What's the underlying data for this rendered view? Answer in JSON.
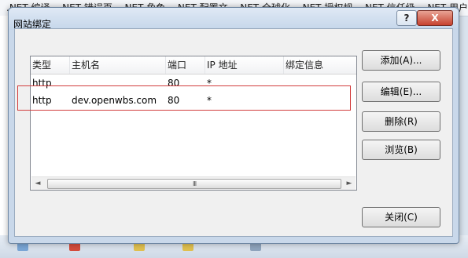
{
  "background": {
    "tabs": [
      ".NET 编译",
      ".NET 错误页",
      ".NET 角色",
      ".NET 配置文",
      ".NET 全球化",
      ".NET 授权规",
      ".NET 信任级",
      ".NET 用户"
    ]
  },
  "dialog": {
    "title": "网站绑定",
    "help_label": "?",
    "close_label": "X"
  },
  "list": {
    "columns": [
      "类型",
      "主机名",
      "端口",
      "IP 地址",
      "绑定信息"
    ],
    "rows": [
      {
        "type": "http",
        "host": "",
        "port": "80",
        "ip": "*",
        "info": ""
      },
      {
        "type": "http",
        "host": "dev.openwbs.com",
        "port": "80",
        "ip": "*",
        "info": ""
      }
    ],
    "scroll_left": "◄",
    "scroll_right": "►",
    "scroll_grip": "III"
  },
  "buttons": {
    "add": "添加(A)...",
    "edit": "编辑(E)...",
    "remove": "删除(R)",
    "browse": "浏览(B)",
    "close": "关闭(C)"
  },
  "colors": {
    "highlight_border": "#d23c3c",
    "close_button": "#c7422f"
  }
}
